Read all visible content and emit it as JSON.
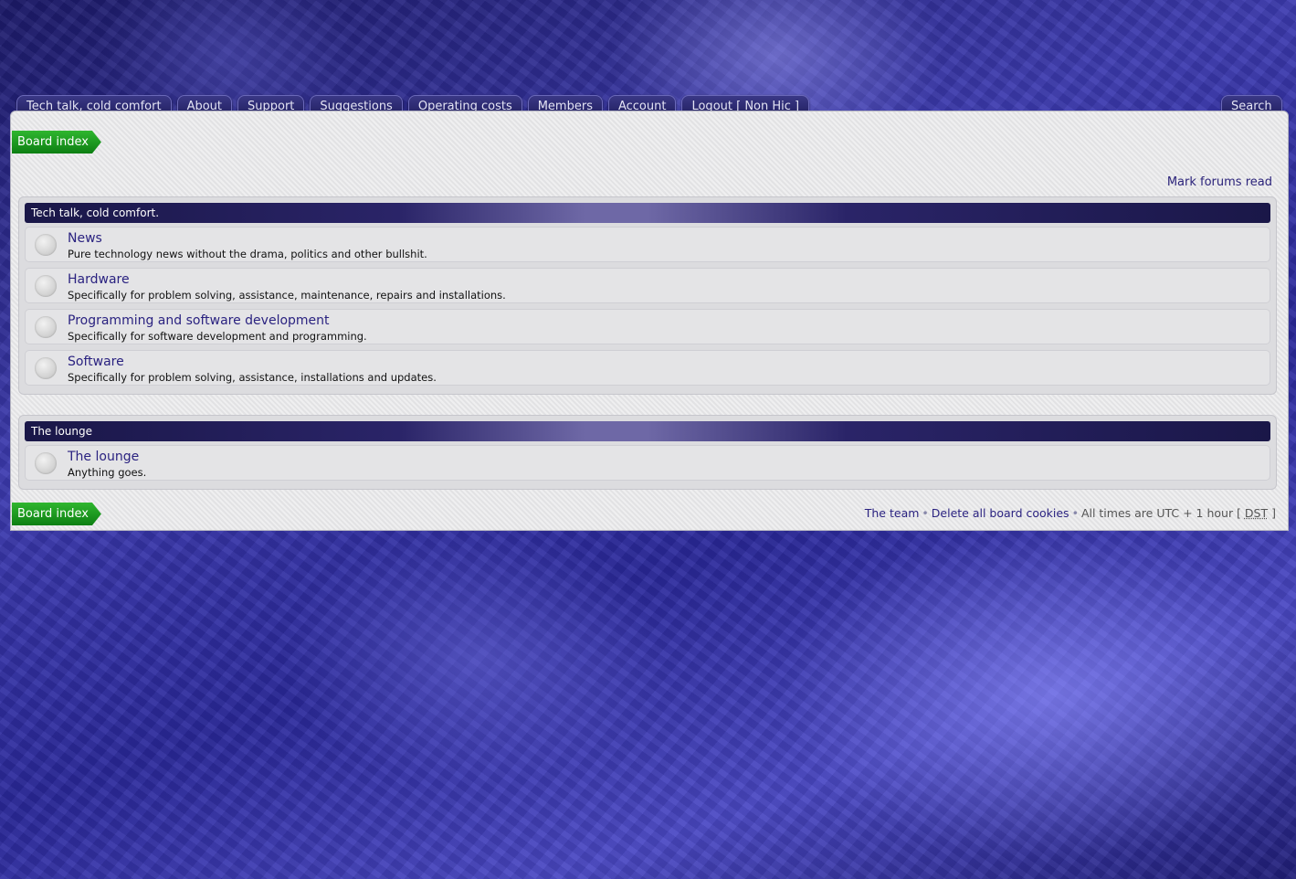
{
  "nav": {
    "tabs": [
      "Tech talk, cold comfort",
      "About",
      "Support",
      "Suggestions",
      "Operating costs",
      "Members",
      "Account",
      "Logout [ Non Hic ]"
    ],
    "search_label": "Search"
  },
  "breadcrumb": {
    "label": "Board index"
  },
  "mark_forums_read": "Mark forums read",
  "categories": [
    {
      "title": "Tech talk, cold comfort.",
      "forums": [
        {
          "title": "News",
          "desc": "Pure technology news without the drama, politics and other bullshit."
        },
        {
          "title": "Hardware",
          "desc": "Specifically for problem solving, assistance, maintenance, repairs and installations."
        },
        {
          "title": "Programming and software development",
          "desc": "Specifically for software development and programming."
        },
        {
          "title": "Software",
          "desc": "Specifically for problem solving, assistance, installations and updates."
        }
      ]
    },
    {
      "title": "The lounge",
      "forums": [
        {
          "title": "The lounge",
          "desc": "Anything goes."
        }
      ]
    }
  ],
  "footer": {
    "team": "The team",
    "delete_cookies": "Delete all board cookies",
    "times_text": "All times are UTC + 1 hour [",
    "dst": "DST",
    "times_end": "]",
    "separator": "•"
  },
  "colors": {
    "tab_bg": "#2a2870",
    "breadcrumb_green": "#1a9a1f",
    "link": "#2a2280",
    "panel_bg": "#e6e6e8"
  }
}
